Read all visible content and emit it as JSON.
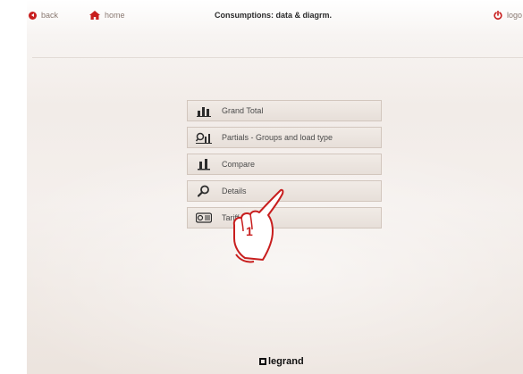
{
  "topbar": {
    "back_label": "back",
    "home_label": "home",
    "title": "Consumptions: data & diagrm.",
    "logout_label": "logo"
  },
  "menu": {
    "items": [
      {
        "label": "Grand Total",
        "icon": "bar-chart-icon"
      },
      {
        "label": "Partials - Groups and load type",
        "icon": "partials-chart-icon"
      },
      {
        "label": "Compare",
        "icon": "compare-icon"
      },
      {
        "label": "Details",
        "icon": "magnifier-icon"
      },
      {
        "label": "Tariff",
        "icon": "tariff-icon"
      }
    ]
  },
  "callout": {
    "number": "1",
    "icon": "pointing-hand-icon"
  },
  "footer": {
    "logo_text": "legrand"
  },
  "colors": {
    "accent": "#c81e1e",
    "menu_bg": "#ebe4de",
    "menu_border": "#d2c6bd"
  }
}
